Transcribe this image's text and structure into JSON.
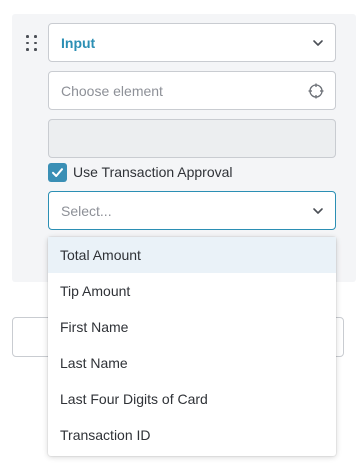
{
  "step": {
    "type_select": {
      "value": "Input"
    },
    "element_input": {
      "placeholder": "Choose element"
    },
    "disabled_field": {
      "value": ""
    },
    "transaction_approval": {
      "label": "Use Transaction Approval",
      "checked": true
    },
    "approval_select": {
      "placeholder": "Select...",
      "options": [
        {
          "label": "Total Amount",
          "highlighted": true
        },
        {
          "label": "Tip Amount",
          "highlighted": false
        },
        {
          "label": "First Name",
          "highlighted": false
        },
        {
          "label": "Last Name",
          "highlighted": false
        },
        {
          "label": "Last Four Digits of Card",
          "highlighted": false
        },
        {
          "label": "Transaction ID",
          "highlighted": false
        }
      ]
    }
  },
  "colors": {
    "accent": "#2b8fb4",
    "checkbox": "#3a8fb5",
    "highlight": "#eaf2f8",
    "panel_bg": "#f4f5f7"
  }
}
